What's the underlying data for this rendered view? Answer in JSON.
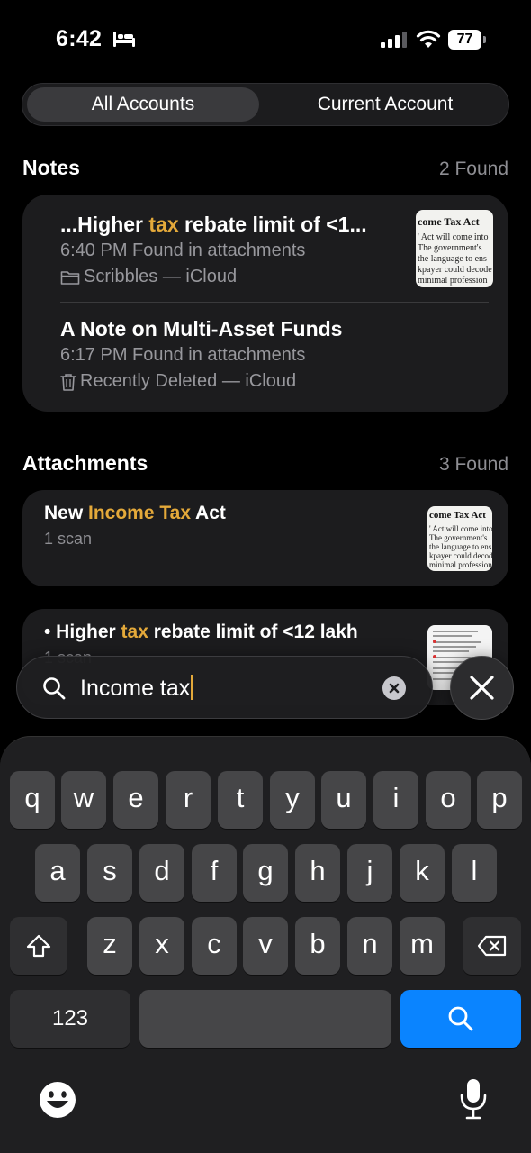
{
  "status_bar": {
    "time": "6:42",
    "battery": "77"
  },
  "segments": {
    "all": "All Accounts",
    "current": "Current Account"
  },
  "notes_section": {
    "title": "Notes",
    "count": "2 Found",
    "items": [
      {
        "title_prefix": "...Higher ",
        "title_highlight": "tax",
        "title_suffix": " rebate limit of <1...",
        "meta": "6:40 PM  Found in attachments",
        "folder": "Scribbles — iCloud",
        "folder_icon": "folder-icon"
      },
      {
        "title": "A Note on Multi-Asset Funds",
        "meta": "6:17 PM  Found in attachments",
        "folder": "Recently Deleted — iCloud",
        "folder_icon": "trash-icon"
      }
    ]
  },
  "thumbnail_text": {
    "heading": "come Tax Act",
    "lines": [
      "' Act will come into",
      " The government's",
      "the language to ens",
      "kpayer could decode",
      "minimal profession"
    ]
  },
  "attachments_section": {
    "title": "Attachments",
    "count": "3 Found",
    "items": [
      {
        "title_prefix": "New ",
        "title_highlight": "Income Tax",
        "title_suffix": " Act",
        "sub": "1 scan"
      },
      {
        "title_prefix": "• Higher ",
        "title_highlight": "tax",
        "title_suffix": " rebate limit of <12 lakh",
        "sub": "1 scan"
      }
    ]
  },
  "search": {
    "query": "Income tax"
  },
  "keyboard": {
    "row1": [
      "q",
      "w",
      "e",
      "r",
      "t",
      "y",
      "u",
      "i",
      "o",
      "p"
    ],
    "row2": [
      "a",
      "s",
      "d",
      "f",
      "g",
      "h",
      "j",
      "k",
      "l"
    ],
    "row3": [
      "z",
      "x",
      "c",
      "v",
      "b",
      "n",
      "m"
    ],
    "numbers_label": "123"
  },
  "colors": {
    "highlight": "#e4a93a",
    "search_key": "#0a84ff",
    "card": "#1c1c1e"
  }
}
